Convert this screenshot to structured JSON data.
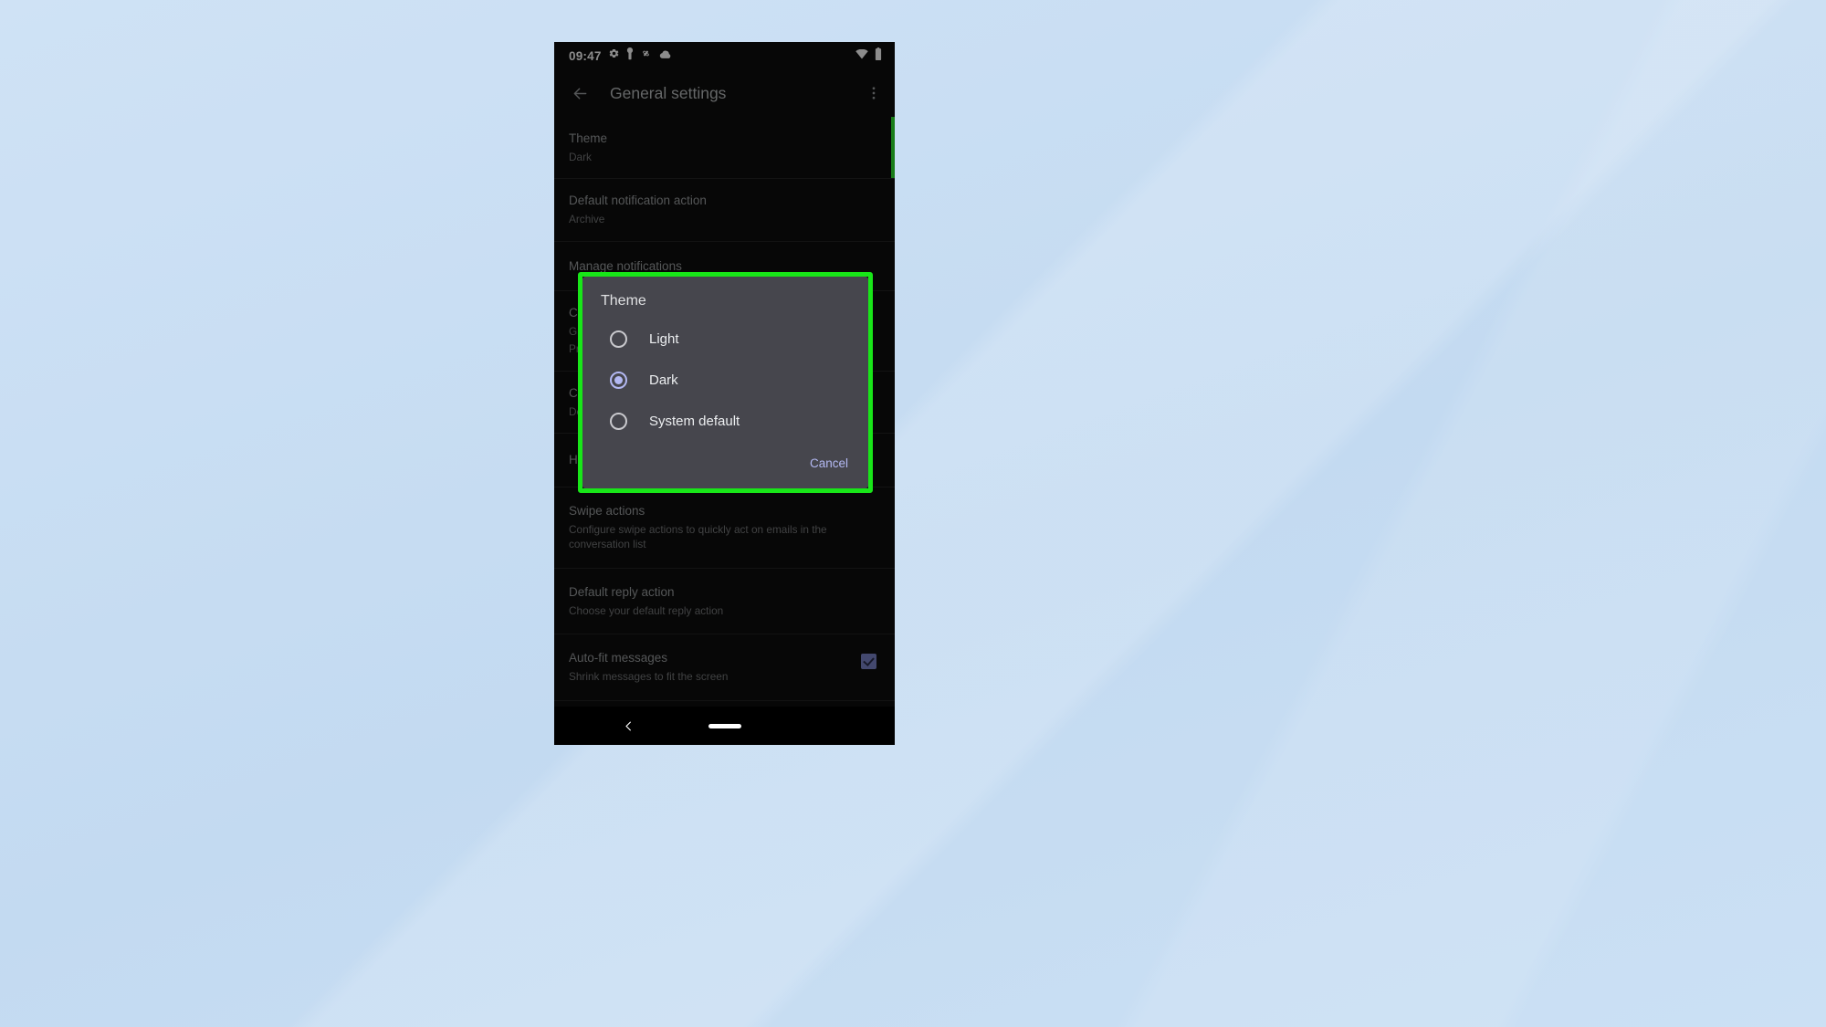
{
  "backdrop": {
    "color": "#c5dcf2"
  },
  "phone": {
    "status_bar": {
      "clock": "09:47",
      "left_icons": [
        "gear-icon",
        "vpn-key-icon",
        "pinwheel-icon",
        "cloud-icon"
      ],
      "right_icons": [
        "wifi-icon",
        "battery-icon"
      ]
    },
    "app_bar": {
      "back_label": "Back",
      "title": "General settings",
      "overflow_label": "More options"
    },
    "settings": [
      {
        "title": "Theme",
        "subtitle": "Dark",
        "highlighted": true,
        "checkbox": null
      },
      {
        "title": "Default notification action",
        "subtitle": "Archive",
        "highlighted": false,
        "checkbox": null
      },
      {
        "title": "Manage notifications",
        "subtitle": "",
        "highlighted": false,
        "checkbox": null
      },
      {
        "title": "Conversation list density",
        "subtitle": "Gmail conversation list density",
        "subtitle2": "Preferences",
        "highlighted": false,
        "checkbox": null
      },
      {
        "title": "Conversation view",
        "subtitle": "Default view settings",
        "highlighted": false,
        "checkbox": null
      },
      {
        "title": "Help and feedback",
        "subtitle": "",
        "highlighted": false,
        "checkbox": null
      },
      {
        "title": "Swipe actions",
        "subtitle": "Configure swipe actions to quickly act on emails in the conversation list",
        "highlighted": false,
        "checkbox": null
      },
      {
        "title": "Default reply action",
        "subtitle": "Choose your default reply action",
        "highlighted": false,
        "checkbox": null
      },
      {
        "title": "Auto-fit messages",
        "subtitle": "Shrink messages to fit the screen",
        "highlighted": false,
        "checkbox": true
      }
    ],
    "dialog": {
      "title": "Theme",
      "options": [
        {
          "label": "Light",
          "selected": false
        },
        {
          "label": "Dark",
          "selected": true
        },
        {
          "label": "System default",
          "selected": false
        }
      ],
      "cancel_label": "Cancel",
      "highlight_color": "#18e618",
      "accent_color": "#b3b8f2",
      "surface_color": "#46464d"
    },
    "nav_bar": {
      "back_label": "Back",
      "home_label": "Home"
    }
  }
}
